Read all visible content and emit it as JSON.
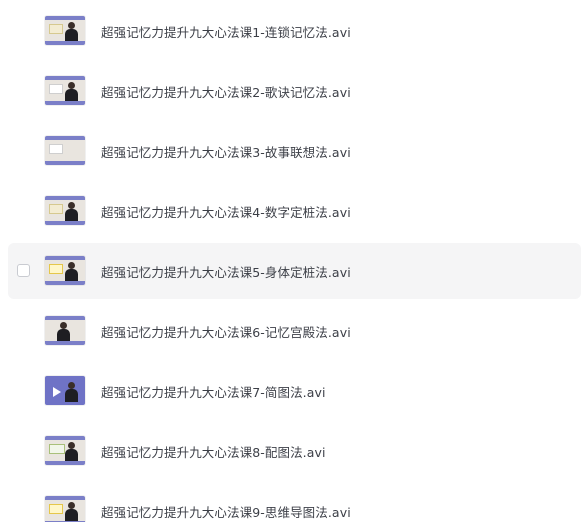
{
  "files": [
    {
      "name": "超强记忆力提升九大心法课1-连锁记忆法.avi",
      "thumbnail": "video-thumbnail"
    },
    {
      "name": "超强记忆力提升九大心法课2-歌诀记忆法.avi",
      "thumbnail": "video-thumbnail"
    },
    {
      "name": "超强记忆力提升九大心法课3-故事联想法.avi",
      "thumbnail": "video-thumbnail"
    },
    {
      "name": "超强记忆力提升九大心法课4-数字定桩法.avi",
      "thumbnail": "video-thumbnail"
    },
    {
      "name": "超强记忆力提升九大心法课5-身体定桩法.avi",
      "thumbnail": "video-thumbnail",
      "hovered": true,
      "checked": false
    },
    {
      "name": "超强记忆力提升九大心法课6-记忆宫殿法.avi",
      "thumbnail": "video-thumbnail"
    },
    {
      "name": "超强记忆力提升九大心法课7-简图法.avi",
      "thumbnail": "video-thumbnail"
    },
    {
      "name": "超强记忆力提升九大心法课8-配图法.avi",
      "thumbnail": "video-thumbnail"
    },
    {
      "name": "超强记忆力提升九大心法课9-思维导图法.avi",
      "thumbnail": "video-thumbnail"
    }
  ],
  "colors": {
    "hover_background": "#f5f5f6",
    "filename_text": "#3c3f47",
    "thumbnail_band": "#7b7fc8"
  }
}
